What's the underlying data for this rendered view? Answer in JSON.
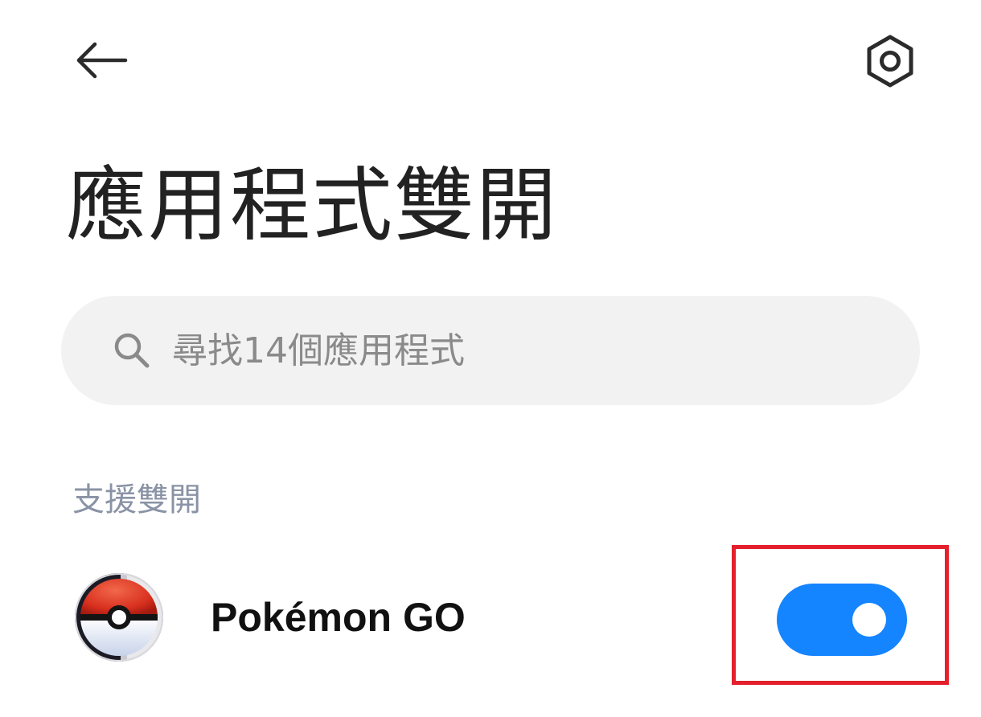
{
  "header": {
    "back_icon": "arrow-left-icon",
    "settings_icon": "hexagon-settings-icon"
  },
  "page": {
    "title": "應用程式雙開"
  },
  "search": {
    "placeholder": "尋找14個應用程式",
    "value": "",
    "icon": "search-icon"
  },
  "sections": [
    {
      "header": "支援雙開",
      "apps": [
        {
          "name": "Pokémon GO",
          "icon": "pokeball-icon",
          "dual_enabled": true
        }
      ]
    }
  ],
  "colors": {
    "toggle_on": "#1484ff",
    "highlight_border": "#e3202c",
    "section_header": "#8a93a6",
    "search_bg": "#f2f2f2"
  }
}
